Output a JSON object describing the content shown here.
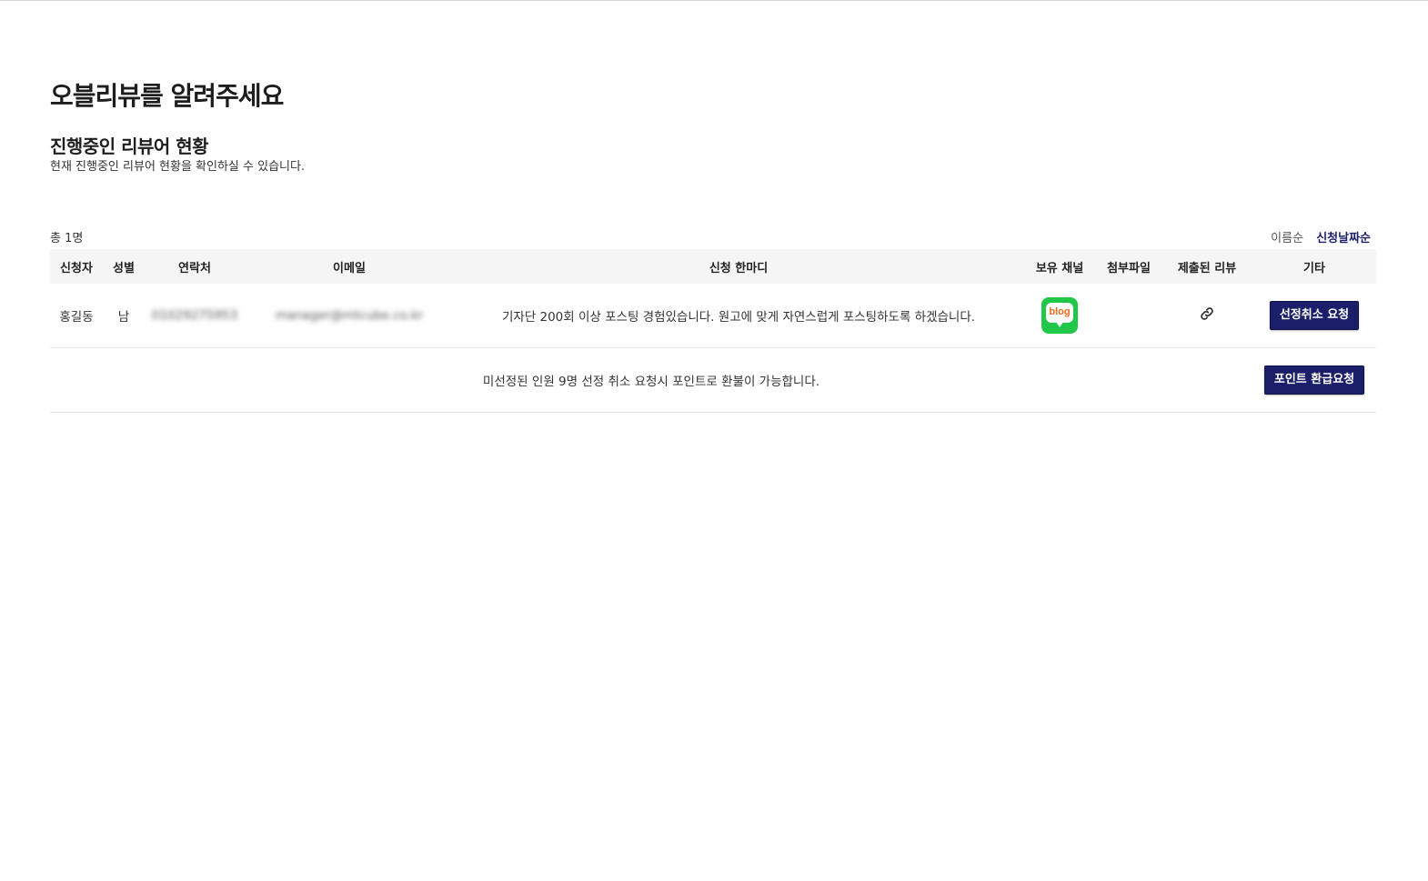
{
  "page": {
    "title": "오블리뷰를 알려주세요",
    "section_title": "진행중인 리뷰어 현황",
    "section_desc": "현재 진행중인 리뷰어 현황을 확인하실 수 있습니다."
  },
  "summary": {
    "total": "총 1명"
  },
  "sort": {
    "by_name": "이름순",
    "by_date": "신청날짜순",
    "active": "by_date"
  },
  "table": {
    "headers": {
      "name": "신청자",
      "gender": "성별",
      "phone": "연락처",
      "email": "이메일",
      "comment": "신청 한마디",
      "channel": "보유 채널",
      "attachment": "첨부파일",
      "submitted_review": "제출된 리뷰",
      "etc": "기타"
    },
    "rows": [
      {
        "name": "홍길동",
        "gender": "남",
        "phone": "01029275953",
        "email": "manager@mtcube.co.kr",
        "comment": "기자단 200회 이상 포스팅 경험있습니다. 원고에 맞게 자연스럽게 포스팅하도록 하겠습니다.",
        "channel_icon": "naver-blog-icon",
        "channel_label": "blog",
        "attachment": "",
        "review_icon": "link-icon",
        "action_label": "선정취소 요청"
      }
    ]
  },
  "notice": {
    "text": "미선정된 인원 9명 선정 취소 요청시 포인트로 환불이 가능합니다.",
    "button_label": "포인트 환급요청"
  },
  "colors": {
    "accent": "#1b1f6a",
    "blog_green": "#20c749",
    "blog_text": "#ee6a1d",
    "header_bg": "#f5f5f5"
  }
}
